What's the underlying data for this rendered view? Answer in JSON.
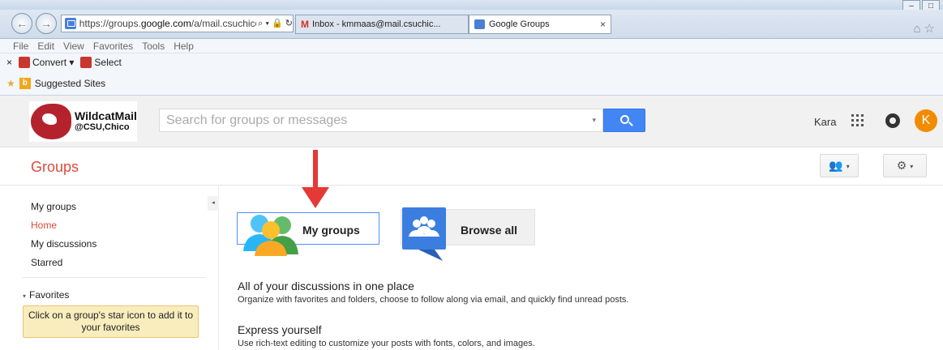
{
  "browser": {
    "url_prefix": "https://groups.",
    "url_domain": "google.com",
    "url_rest": "/a/mail.csuchico.e",
    "addr_tools": "⌕ ▾ 🔒 ↻",
    "tabs": [
      {
        "label": "Inbox - kmmaas@mail.csuchic...",
        "icon": "gmail-icon"
      },
      {
        "label": "Google Groups",
        "icon": "google-groups-icon"
      }
    ],
    "tab_close": "×",
    "menu": [
      "File",
      "Edit",
      "View",
      "Favorites",
      "Tools",
      "Help"
    ],
    "cmd_close": "×",
    "convert_label": "Convert",
    "convert_dropdown": "▾",
    "select_label": "Select",
    "suggested_sites": "Suggested Sites",
    "home_star": "⌂☆",
    "window_buttons": [
      "–",
      "□"
    ]
  },
  "header": {
    "logo_title": "WildcatMail",
    "logo_subtitle": "@CSU,Chico",
    "search_placeholder": "Search for groups or messages",
    "search_caret": "▾",
    "user_name": "Kara",
    "avatar_letter": "K"
  },
  "groupsbar": {
    "title": "Groups",
    "people_button": "👥",
    "settings_button": "⚙",
    "dropdown": "▾"
  },
  "sidebar": {
    "collapse": "◂",
    "items": [
      {
        "label": "My groups",
        "active": false
      },
      {
        "label": "Home",
        "active": true
      },
      {
        "label": "My discussions",
        "active": false
      },
      {
        "label": "Starred",
        "active": false
      }
    ],
    "favorites_toggle": "▾",
    "favorites_heading": "Favorites",
    "favorites_note": "Click on a group's star icon to add it to your favorites"
  },
  "main": {
    "my_groups_label": "My groups",
    "browse_all_label": "Browse all",
    "sections": [
      {
        "title": "All of your discussions in one place",
        "text": "Organize with favorites and folders, choose to follow along via email, and quickly find unread posts."
      },
      {
        "title": "Express yourself",
        "text": "Use rich-text editing to customize your posts with fonts, colors, and images."
      }
    ]
  },
  "colors": {
    "accent_red": "#dd4b39",
    "search_blue": "#4285f4",
    "avatar_orange": "#f28b00",
    "arrow_red": "#e53935"
  }
}
